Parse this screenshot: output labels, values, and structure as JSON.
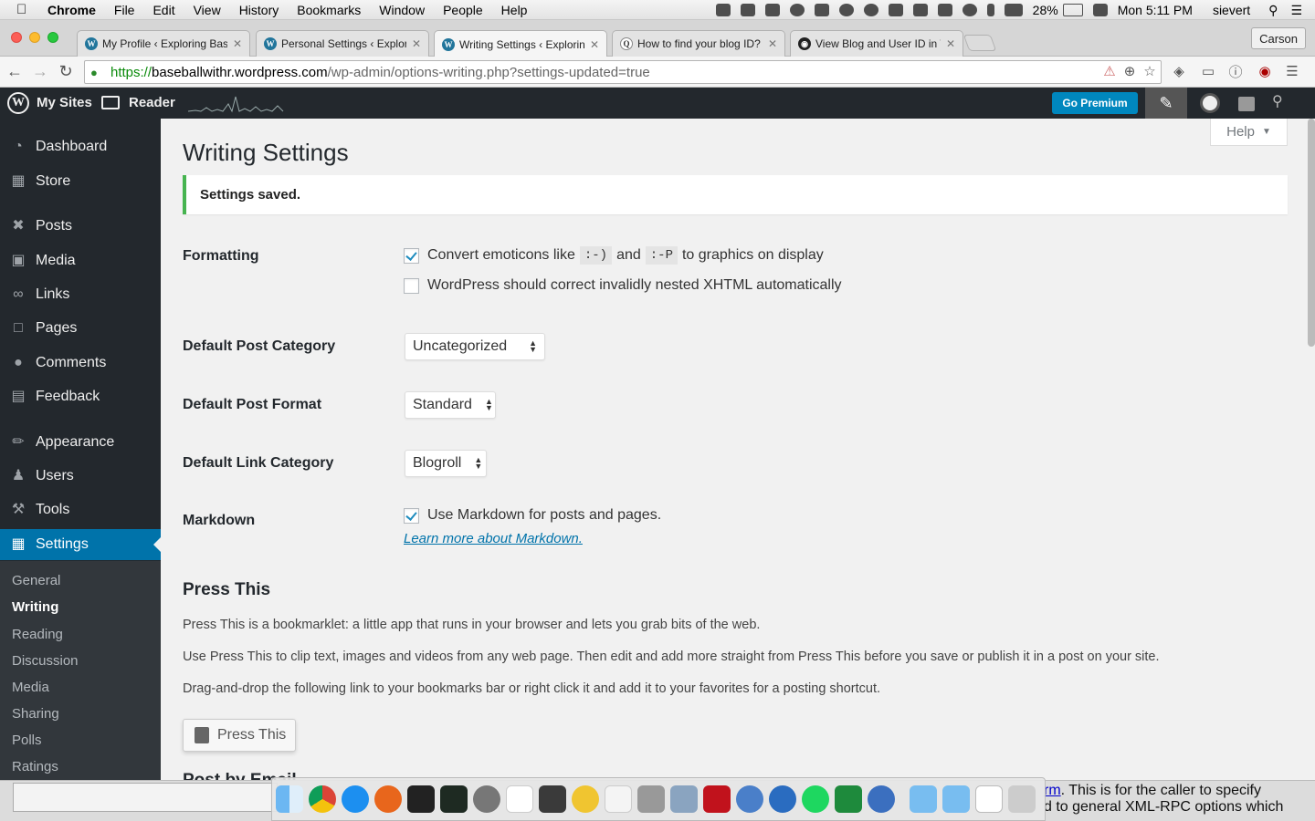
{
  "menubar": {
    "app": "Chrome",
    "items": [
      "File",
      "Edit",
      "View",
      "History",
      "Bookmarks",
      "Window",
      "People",
      "Help"
    ],
    "battery": "28%",
    "clock": "Mon 5:11 PM",
    "user": "sievert"
  },
  "tabs": [
    {
      "title": "My Profile ‹ Exploring Base",
      "favicon": "wordpress-icon"
    },
    {
      "title": "Personal Settings ‹ Explori",
      "favicon": "wordpress-icon"
    },
    {
      "title": "Writing Settings ‹ Exploring",
      "favicon": "wordpress-icon"
    },
    {
      "title": "How to find your blog ID?",
      "favicon": "quora-icon"
    },
    {
      "title": "View Blog and User ID in W",
      "favicon": "github-icon"
    }
  ],
  "profile_button": "Carson",
  "omnibox": {
    "scheme": "https://",
    "host": "baseballwithr.wordpress.com",
    "path": "/wp-admin/options-writing.php?settings-updated=true"
  },
  "adminbar": {
    "my_sites": "My Sites",
    "reader": "Reader",
    "go_premium": "Go Premium"
  },
  "sidebar": {
    "items": [
      {
        "label": "Dashboard",
        "icon": "dashboard-icon"
      },
      {
        "label": "Store",
        "icon": "cart-icon"
      },
      {
        "label": "Posts",
        "icon": "pin-icon"
      },
      {
        "label": "Media",
        "icon": "media-icon"
      },
      {
        "label": "Links",
        "icon": "link-icon"
      },
      {
        "label": "Pages",
        "icon": "pages-icon"
      },
      {
        "label": "Comments",
        "icon": "comment-icon"
      },
      {
        "label": "Feedback",
        "icon": "feedback-icon"
      },
      {
        "label": "Appearance",
        "icon": "brush-icon"
      },
      {
        "label": "Users",
        "icon": "user-icon"
      },
      {
        "label": "Tools",
        "icon": "wrench-icon"
      },
      {
        "label": "Settings",
        "icon": "settings-icon"
      }
    ],
    "submenu": [
      "General",
      "Writing",
      "Reading",
      "Discussion",
      "Media",
      "Sharing",
      "Polls",
      "Ratings"
    ],
    "active_item": "Settings",
    "active_submenu": "Writing"
  },
  "page": {
    "help": "Help",
    "title": "Writing Settings",
    "notice": "Settings saved.",
    "formatting": {
      "label": "Formatting",
      "emoticons_pre": "Convert emoticons like",
      "emoticon_1": ":-)",
      "and": "and",
      "emoticon_2": ":-P",
      "emoticons_post": "to graphics on display",
      "emoticons_checked": true,
      "xhtml": "WordPress should correct invalidly nested XHTML automatically",
      "xhtml_checked": false
    },
    "default_post_category": {
      "label": "Default Post Category",
      "value": "Uncategorized"
    },
    "default_post_format": {
      "label": "Default Post Format",
      "value": "Standard"
    },
    "default_link_category": {
      "label": "Default Link Category",
      "value": "Blogroll"
    },
    "markdown": {
      "label": "Markdown",
      "option": "Use Markdown for posts and pages.",
      "checked": true,
      "learn_more": "Learn more about Markdown."
    },
    "press_this": {
      "title": "Press This",
      "p1": "Press This is a bookmarklet: a little app that runs in your browser and lets you grab bits of the web.",
      "p2": "Use Press This to clip text, images and videos from any web page. Then edit and add more straight from Press This before you save or publish it in a post on your site.",
      "p3": "Drag-and-drop the following link to your bookmarks bar or right click it and add it to your favorites for a posting shortcut.",
      "button": "Press This"
    },
    "next_section": "Post by Email"
  },
  "background_window": {
    "line1_link": "rm",
    "line1_text": ". This is for the caller to specify",
    "line2": "d to general XML-RPC options which"
  },
  "colors": {
    "admin_dark": "#23282d",
    "accent": "#0073aa",
    "premium": "#0087be",
    "success": "#46b450"
  }
}
